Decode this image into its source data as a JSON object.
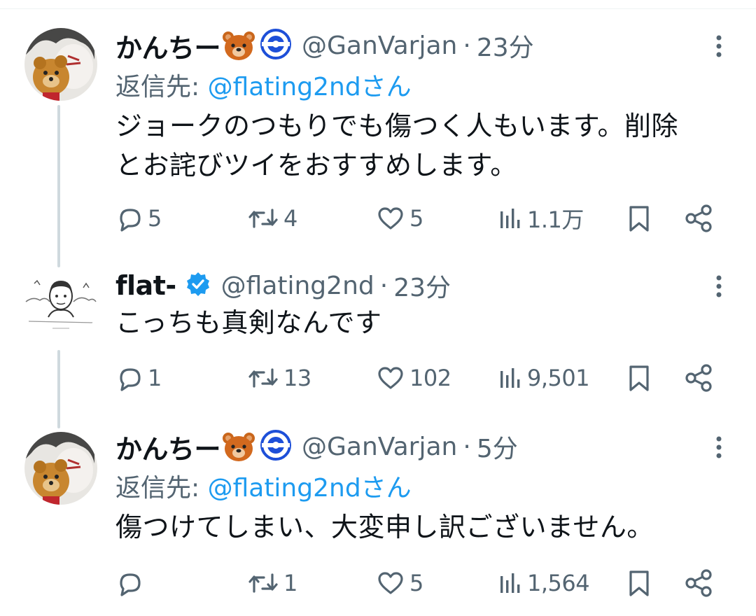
{
  "tweets": [
    {
      "display_name": "かんちー",
      "handle": "@GanVarjan",
      "separator": "·",
      "time": "23分",
      "reply_label": "返信先: ",
      "reply_to": "@flating2ndさん",
      "text_lines": [
        "ジョークのつもりでも傷つく人もいます。削除",
        "とお詫びツイをおすすめします。"
      ],
      "replies": "5",
      "retweets": "4",
      "likes": "5",
      "views": "1.1万"
    },
    {
      "display_name": "flat-",
      "verified": true,
      "handle": "@flating2nd",
      "separator": "·",
      "time": "23分",
      "text_lines": [
        "こっちも真剣なんです"
      ],
      "replies": "1",
      "retweets": "13",
      "likes": "102",
      "views": "9,501"
    },
    {
      "display_name": "かんちー",
      "handle": "@GanVarjan",
      "separator": "·",
      "time": "5分",
      "reply_label": "返信先: ",
      "reply_to": "@flating2ndさん",
      "text_lines": [
        "傷つけてしまい、大変申し訳ございません。"
      ],
      "replies": "",
      "retweets": "1",
      "likes": "5",
      "views": "1,564"
    }
  ],
  "colors": {
    "text": "#0f1419",
    "secondary": "#536471",
    "link": "#1d9bf0",
    "verified": "#1d9bf0",
    "thread_line": "#cfd9de",
    "bear": "#d2691e"
  },
  "icons": {
    "reply": "speech-bubble-icon",
    "retweet": "retweet-icon",
    "like": "heart-icon",
    "views": "bar-chart-icon",
    "bookmark": "bookmark-icon",
    "share": "share-icon",
    "more": "more-vertical-icon",
    "emoji_bear": "bear-face-emoji",
    "emoji_badge": "blue-ring-badge",
    "verified": "verified-badge-icon"
  }
}
